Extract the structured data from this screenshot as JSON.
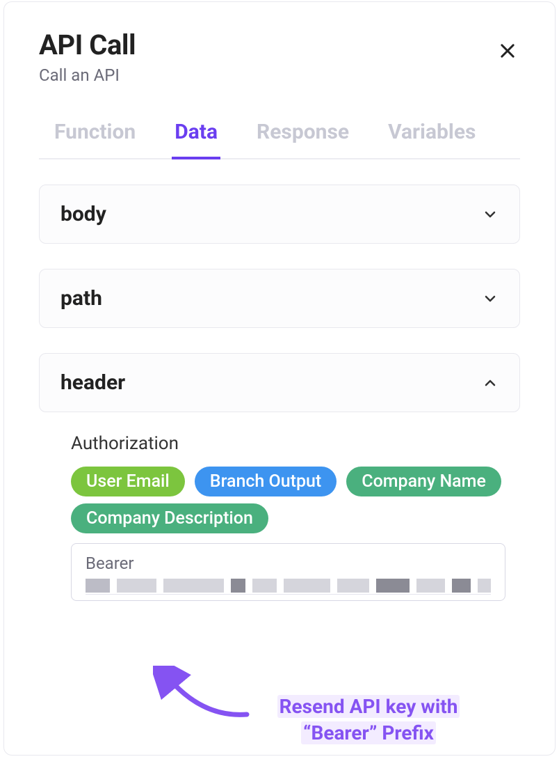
{
  "header": {
    "title": "API Call",
    "subtitle": "Call an API"
  },
  "tabs": [
    {
      "label": "Function",
      "active": false
    },
    {
      "label": "Data",
      "active": true
    },
    {
      "label": "Response",
      "active": false
    },
    {
      "label": "Variables",
      "active": false
    }
  ],
  "sections": {
    "body": {
      "label": "body",
      "expanded": false
    },
    "path": {
      "label": "path",
      "expanded": false
    },
    "header": {
      "label": "header",
      "expanded": true
    }
  },
  "headerField": {
    "name": "Authorization",
    "chips": [
      {
        "label": "User Email",
        "color": "green-light"
      },
      {
        "label": "Branch Output",
        "color": "blue"
      },
      {
        "label": "Company Name",
        "color": "green"
      },
      {
        "label": "Company Description",
        "color": "green"
      }
    ],
    "inputValue": "Bearer"
  },
  "annotation": {
    "line1": "Resend API key with",
    "line2": "“Bearer” Prefix"
  }
}
